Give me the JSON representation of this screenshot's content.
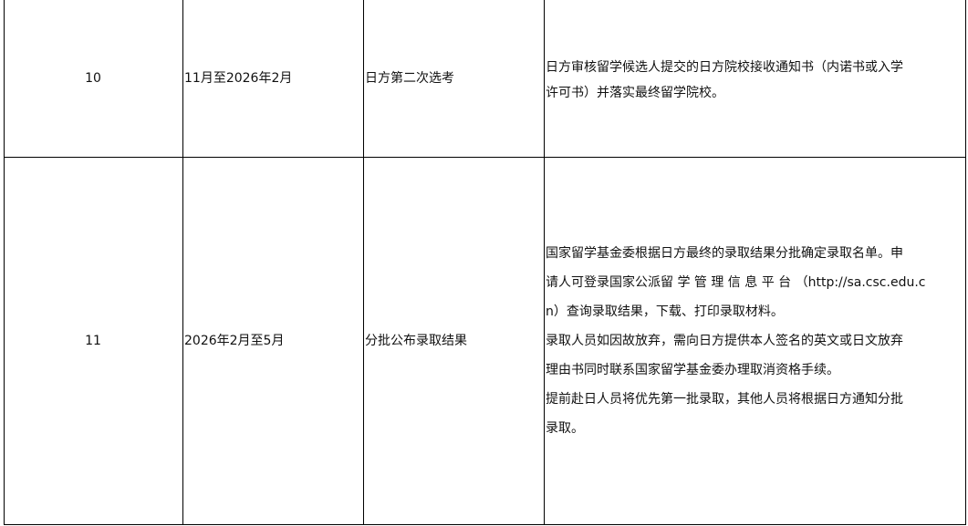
{
  "rows": [
    {
      "no": "10",
      "period": "11月至2026年2月",
      "stage": "日方第二次选考",
      "content": [
        "日方审核留学候选人提交的日方院校接收通知书（内诺书或入学",
        "许可书）并落实最终留学院校。"
      ]
    },
    {
      "no": "11",
      "period": "2026年2月至5月",
      "stage": "分批公布录取结果",
      "content": [
        "国家留学基金委根据日方最终的录取结果分批确定录取名单。申",
        "请人可登录国家公派留 学 管 理 信 息 平 台 （http://sa.csc.edu.c",
        "n）查询录取结果，下载、打印录取材料。",
        "录取人员如因故放弃，需向日方提供本人签名的英文或日文放弃",
        "理由书同时联系国家留学基金委办理取消资格手续。",
        "提前赴日人员将优先第一批录取，其他人员将根据日方通知分批",
        "录取。"
      ]
    }
  ]
}
